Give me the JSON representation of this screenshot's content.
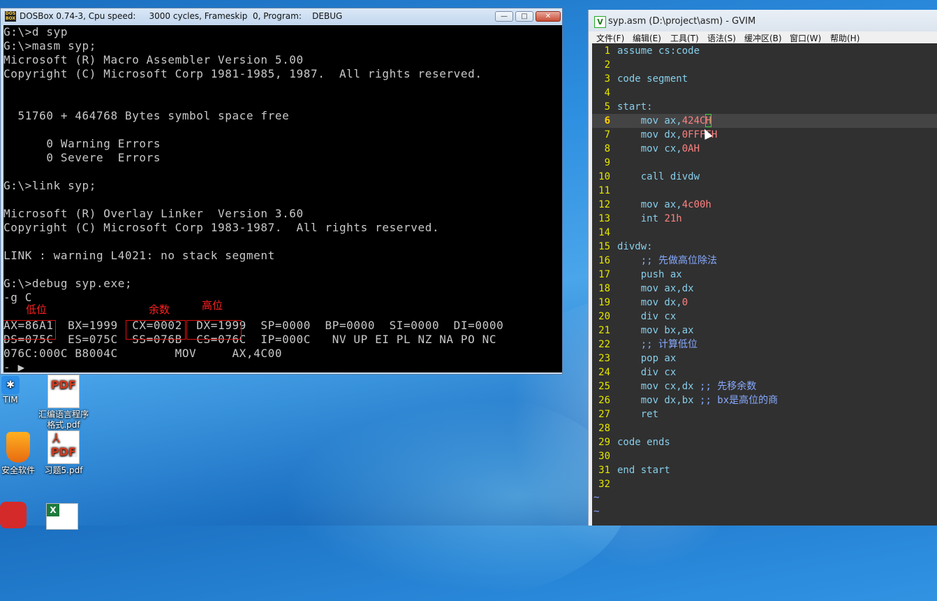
{
  "desktop": {
    "icons": [
      {
        "label": "TIM"
      },
      {
        "label": "汇编语言程序\n格式.pdf",
        "badge": "PDF"
      },
      {
        "label": "安全软件"
      },
      {
        "label": "习题5.pdf",
        "badge": "PDF"
      }
    ]
  },
  "dosbox": {
    "title": "DOSBox 0.74-3, Cpu speed:     3000 cycles, Frameskip  0, Program:    DEBUG",
    "icon_text": "DOS\nBOX",
    "controls": {
      "minimize": "—",
      "maximize": "□",
      "close": "✕"
    },
    "lines": [
      "G:\\>d syp",
      "G:\\>masm syp;",
      "Microsoft (R) Macro Assembler Version 5.00",
      "Copyright (C) Microsoft Corp 1981-1985, 1987.  All rights reserved.",
      "",
      "",
      "  51760 + 464768 Bytes symbol space free",
      "",
      "      0 Warning Errors",
      "      0 Severe  Errors",
      "",
      "G:\\>link syp;",
      "",
      "Microsoft (R) Overlay Linker  Version 3.60",
      "Copyright (C) Microsoft Corp 1983-1987.  All rights reserved.",
      "",
      "LINK : warning L4021: no stack segment",
      "",
      "G:\\>debug syp.exe;",
      "-g C",
      "",
      "AX=86A1  BX=1999  CX=0002  DX=1999  SP=0000  BP=0000  SI=0000  DI=0000",
      "DS=075C  ES=075C  SS=076B  CS=076C  IP=000C   NV UP EI PL NZ NA PO NC",
      "076C:000C B8004C        MOV     AX,4C00",
      "- ▶"
    ],
    "annotations": [
      {
        "label": "低位"
      },
      {
        "label": "余数"
      },
      {
        "label": "高位"
      }
    ]
  },
  "gvim": {
    "title": "syp.asm (D:\\project\\asm) - GVIM",
    "menu": [
      "文件(F)",
      "编辑(E)",
      "工具(T)",
      "语法(S)",
      "缓冲区(B)",
      "窗口(W)",
      "帮助(H)"
    ],
    "current_line": 6,
    "lines": [
      {
        "n": "1",
        "t": "assume cs:code"
      },
      {
        "n": "2",
        "t": ""
      },
      {
        "n": "3",
        "t": "code segment"
      },
      {
        "n": "4",
        "t": ""
      },
      {
        "n": "5",
        "t": "start:"
      },
      {
        "n": "6",
        "t": "    mov ax,424CH"
      },
      {
        "n": "7",
        "t": "    mov dx,0FFFFH"
      },
      {
        "n": "8",
        "t": "    mov cx,0AH"
      },
      {
        "n": "9",
        "t": ""
      },
      {
        "n": "10",
        "t": "    call divdw"
      },
      {
        "n": "11",
        "t": ""
      },
      {
        "n": "12",
        "t": "    mov ax,4c00h"
      },
      {
        "n": "13",
        "t": "    int 21h"
      },
      {
        "n": "14",
        "t": ""
      },
      {
        "n": "15",
        "t": "divdw:"
      },
      {
        "n": "16",
        "t": "    ;; 先做高位除法"
      },
      {
        "n": "17",
        "t": "    push ax"
      },
      {
        "n": "18",
        "t": "    mov ax,dx"
      },
      {
        "n": "19",
        "t": "    mov dx,0"
      },
      {
        "n": "20",
        "t": "    div cx"
      },
      {
        "n": "21",
        "t": "    mov bx,ax"
      },
      {
        "n": "22",
        "t": "    ;; 计算低位"
      },
      {
        "n": "23",
        "t": "    pop ax"
      },
      {
        "n": "24",
        "t": "    div cx"
      },
      {
        "n": "25",
        "t": "    mov cx,dx ;; 先移余数"
      },
      {
        "n": "26",
        "t": "    mov dx,bx ;; bx是高位的商"
      },
      {
        "n": "27",
        "t": "    ret"
      },
      {
        "n": "28",
        "t": ""
      },
      {
        "n": "29",
        "t": "code ends"
      },
      {
        "n": "30",
        "t": ""
      },
      {
        "n": "31",
        "t": "end start"
      },
      {
        "n": "32",
        "t": ""
      }
    ],
    "tildes": [
      "~",
      "~"
    ],
    "colors": {
      "background": "#303030",
      "line_number": "#e6e600",
      "keyword": "#87ceeb",
      "number": "#ff8080",
      "comment": "#87aaff"
    }
  }
}
